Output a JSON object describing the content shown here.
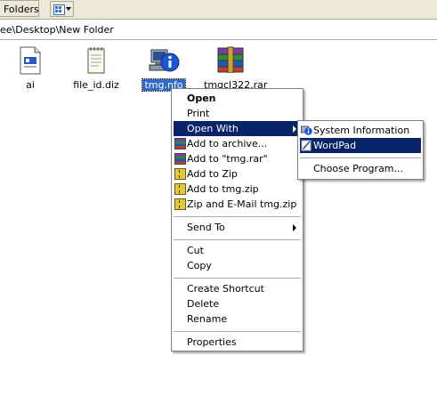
{
  "toolbar": {
    "folders_label": "Folders"
  },
  "address": {
    "path": "ee\\Desktop\\New Folder"
  },
  "files": [
    {
      "name": "ai",
      "icon": "document-icon"
    },
    {
      "name": "file_id.diz",
      "icon": "notepad-icon"
    },
    {
      "name": "tmg.nfo",
      "icon": "system-info-icon",
      "selected": true
    },
    {
      "name": "tmgcl322.rar",
      "icon": "winrar-archive-icon"
    }
  ],
  "context_menu": {
    "open": "Open",
    "print": "Print",
    "open_with": "Open With",
    "add_archive": "Add to archive...",
    "add_rar": "Add to \"tmg.rar\"",
    "add_zip": "Add to Zip",
    "add_tmg_zip": "Add to tmg.zip",
    "zip_email": "Zip and E-Mail tmg.zip",
    "send_to": "Send To",
    "cut": "Cut",
    "copy": "Copy",
    "create_shortcut": "Create Shortcut",
    "delete": "Delete",
    "rename": "Rename",
    "properties": "Properties"
  },
  "open_with_menu": {
    "system_information": "System Information",
    "wordpad": "WordPad",
    "choose_program": "Choose Program..."
  },
  "colors": {
    "highlight": "#0a246a",
    "selection": "#316ac5",
    "chrome": "#ece9d8"
  }
}
